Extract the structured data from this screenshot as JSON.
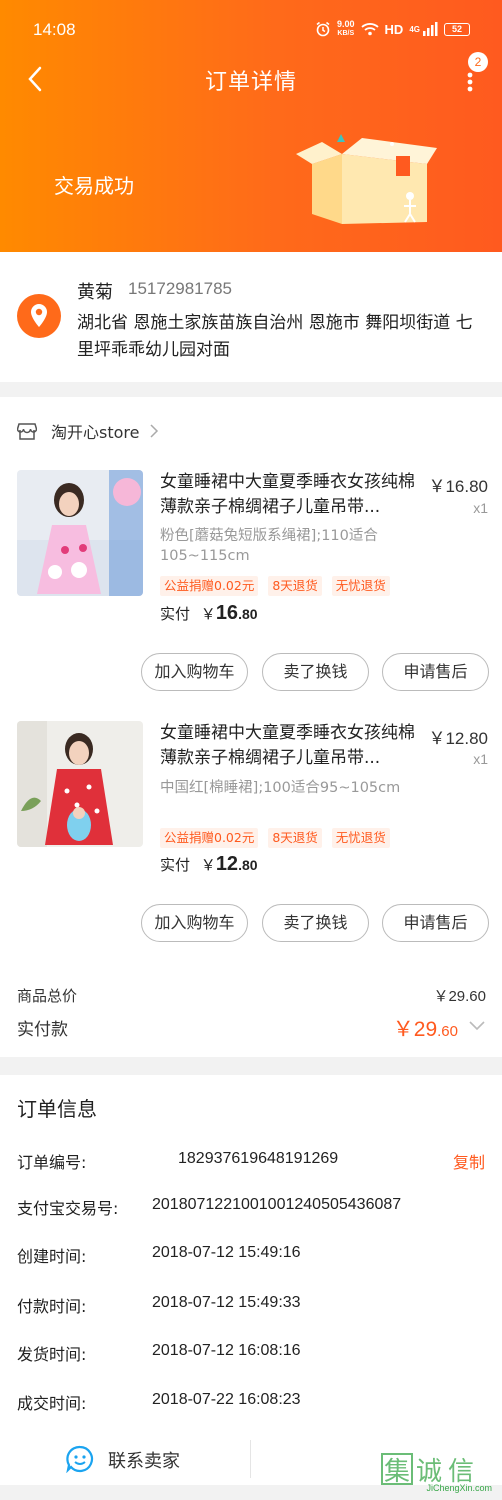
{
  "status_bar": {
    "time": "14:08",
    "speed_value": "9.00",
    "speed_unit": "KB/S",
    "network": "HD",
    "signal": "4G",
    "battery": "52"
  },
  "nav": {
    "title": "订单详情",
    "badge_count": "2"
  },
  "header": {
    "trade_status": "交易成功"
  },
  "address": {
    "name": "黄菊",
    "phone": "15172981785",
    "text": "湖北省 恩施土家族苗族自治州 恩施市 舞阳坝街道 七里坪乖乖幼儿园对面"
  },
  "store": {
    "name": "淘开心store"
  },
  "products": [
    {
      "title": "女童睡裙中大童夏季睡衣女孩纯棉薄款亲子棉绸裙子儿童吊带...",
      "price": "￥16.80",
      "qty": "x1",
      "spec": "粉色[蘑菇兔短版系绳裙];110适合105~115cm",
      "tags": [
        "公益捐赠0.02元",
        "8天退货",
        "无忧退货"
      ],
      "paid_label": "实付",
      "paid_symbol": "￥",
      "paid_int": "16",
      "paid_dec": ".80",
      "buttons": [
        "加入购物车",
        "卖了换钱",
        "申请售后"
      ]
    },
    {
      "title": "女童睡裙中大童夏季睡衣女孩纯棉薄款亲子棉绸裙子儿童吊带...",
      "price": "￥12.80",
      "qty": "x1",
      "spec": "中国红[棉睡裙];100适合95~105cm",
      "tags": [
        "公益捐赠0.02元",
        "8天退货",
        "无忧退货"
      ],
      "paid_label": "实付",
      "paid_symbol": "￥",
      "paid_int": "12",
      "paid_dec": ".80",
      "buttons": [
        "加入购物车",
        "卖了换钱",
        "申请售后"
      ]
    }
  ],
  "summary": {
    "total_label": "商品总价",
    "total_value": "￥29.60",
    "paid_label": "实付款",
    "paid_int": "￥29",
    "paid_dec": ".60"
  },
  "order_info": {
    "title": "订单信息",
    "copy_label": "复制",
    "rows": [
      {
        "label": "订单编号:",
        "value": "182937619648191269"
      },
      {
        "label": "支付宝交易号:",
        "value": "2018071221001001240505436087"
      },
      {
        "label": "创建时间:",
        "value": "2018-07-12 15:49:16"
      },
      {
        "label": "付款时间:",
        "value": "2018-07-12 15:49:33"
      },
      {
        "label": "发货时间:",
        "value": "2018-07-12 16:08:16"
      },
      {
        "label": "成交时间:",
        "value": "2018-07-22 16:08:23"
      }
    ]
  },
  "bottom": {
    "contact_label": "联系卖家",
    "watermark_text": "集诚信",
    "watermark_url": "JiChengXin.com"
  },
  "colors": {
    "accent": "#ff6a1a",
    "price_red": "#ff5a1f"
  }
}
